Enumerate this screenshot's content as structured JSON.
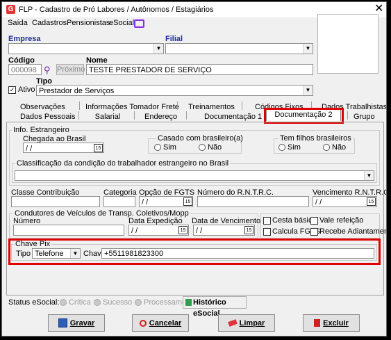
{
  "window": {
    "title": "FLP - Cadastro de Pró Labores / Autônomos / Estagiários",
    "close_glyph": "✕"
  },
  "menu": [
    "Saída",
    "Cadastros",
    "Pensionistas",
    "eSocial"
  ],
  "empresa": {
    "label": "Empresa",
    "value": ""
  },
  "filial": {
    "label": "Filial",
    "value": ""
  },
  "codigo": {
    "label": "Código",
    "value": "000098",
    "proximo_label": "Próximo"
  },
  "nome": {
    "label": "Nome",
    "value": "TESTE PRESTADOR DE SERVIÇO"
  },
  "tipo": {
    "label": "Tipo",
    "value": "Prestador de Serviços"
  },
  "ativo": {
    "label": "Ativo",
    "checked": true
  },
  "tabs_row1": [
    "Observações",
    "Informações Tomador Frete",
    "Treinamentos",
    "Códigos Fixos",
    "Dados Trabalhistas"
  ],
  "tabs_row2": [
    "Dados Pessoais",
    "Salarial",
    "Endereço",
    "Documentação 1",
    "Documentação 2",
    "Grupo"
  ],
  "active_tab": "Documentação 2",
  "info_estrangeiro": {
    "title": "Info. Estrangeiro",
    "chegada_label": "Chegada ao Brasil",
    "chegada_value": " / /",
    "casado": {
      "title": "Casado com brasileiro(a)",
      "sim": "Sim",
      "nao": "Não"
    },
    "filhos": {
      "title": "Tem filhos brasileiros",
      "sim": "Sim",
      "nao": "Não"
    },
    "classificacao_title": "Classificação da condição do trabalhador estrangeiro no Brasil",
    "classificacao_value": ""
  },
  "contribuicao": {
    "classe_label": "Classe Contribuição",
    "classe_value": "",
    "categoria_label": "Categoria",
    "categoria_value": "",
    "opcao_fgts_label": "Opção de FGTS",
    "opcao_fgts_value": " / /",
    "rntrc_label": "Número do R.N.T.R.C.",
    "rntrc_value": "",
    "venc_rntrc_label": "Vencimento R.N.T.R.C.",
    "venc_rntrc_value": " / /"
  },
  "condutores": {
    "title": "Condutores de Veículos de Transp. Coletivos/Mopp",
    "numero_label": "Número",
    "numero_value": "",
    "expedicao_label": "Data Expedição",
    "expedicao_value": " / /",
    "vencimento_label": "Data de Vencimento",
    "vencimento_value": " / /"
  },
  "options": {
    "cesta_basica": "Cesta básica",
    "vale_refeicao": "Vale refeição",
    "calcula_fgts": "Calcula FGTS",
    "recebe_adiantamento": "Recebe Adiantamento"
  },
  "chave_pix": {
    "title": "Chave Pix",
    "tipo_label": "Tipo",
    "tipo_value": "Telefone",
    "chave_label": "Chave",
    "chave_value": "+5511981823300"
  },
  "status": {
    "label": "Status eSocial:",
    "critica": "Crítica",
    "sucesso": "Sucesso",
    "processamento": "Processamento",
    "historico": "Histórico eSocial"
  },
  "buttons": {
    "gravar": "Gravar",
    "cancelar": "Cancelar",
    "limpar": "Limpar",
    "excluir": "Excluir"
  },
  "colors": {
    "highlight": "#e00000",
    "label_blue": "#1e2d9a"
  }
}
